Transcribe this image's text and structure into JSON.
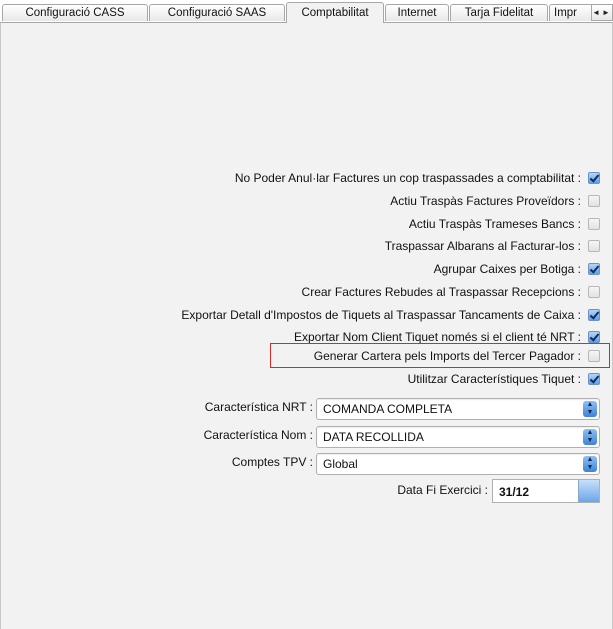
{
  "tabs": [
    {
      "label": "Configuració CASS"
    },
    {
      "label": "Configuració SAAS"
    },
    {
      "label": "Comptabilitat"
    },
    {
      "label": "Internet"
    },
    {
      "label": "Tarja Fidelitat"
    },
    {
      "label": "Impr"
    }
  ],
  "active_tab": "Comptabilitat",
  "options": [
    {
      "label": "No Poder Anul·lar Factures un cop traspassades a comptabilitat :",
      "checked": true
    },
    {
      "label": "Actiu Traspàs Factures Proveïdors :",
      "checked": false
    },
    {
      "label": "Actiu Traspàs Trameses Bancs :",
      "checked": false
    },
    {
      "label": "Traspassar Albarans al Facturar-los :",
      "checked": false
    },
    {
      "label": "Agrupar Caixes per Botiga :",
      "checked": true
    },
    {
      "label": "Crear Factures Rebudes al Traspassar Recepcions :",
      "checked": false
    },
    {
      "label": "Exportar Detall d'Impostos de Tiquets al Traspassar Tancaments de Caixa :",
      "checked": true
    },
    {
      "label": "Exportar Nom Client Tiquet només si el client té NRT :",
      "checked": true
    },
    {
      "label": "Generar Cartera pels Imports del Tercer Pagador :",
      "checked": false
    },
    {
      "label": "Utilitzar Característiques Tiquet :",
      "checked": true
    }
  ],
  "selects": {
    "nrt": {
      "label": "Característica NRT :",
      "value": "COMANDA COMPLETA"
    },
    "nom": {
      "label": "Característica Nom :",
      "value": "DATA RECOLLIDA"
    },
    "tpv": {
      "label": "Comptes TPV :",
      "value": "Global"
    }
  },
  "fiscal": {
    "label": "Data Fi Exercici :",
    "value": "31/12"
  },
  "colors": {
    "highlight": "#d62a2a",
    "checkbox_on": "#5d9fe6"
  }
}
